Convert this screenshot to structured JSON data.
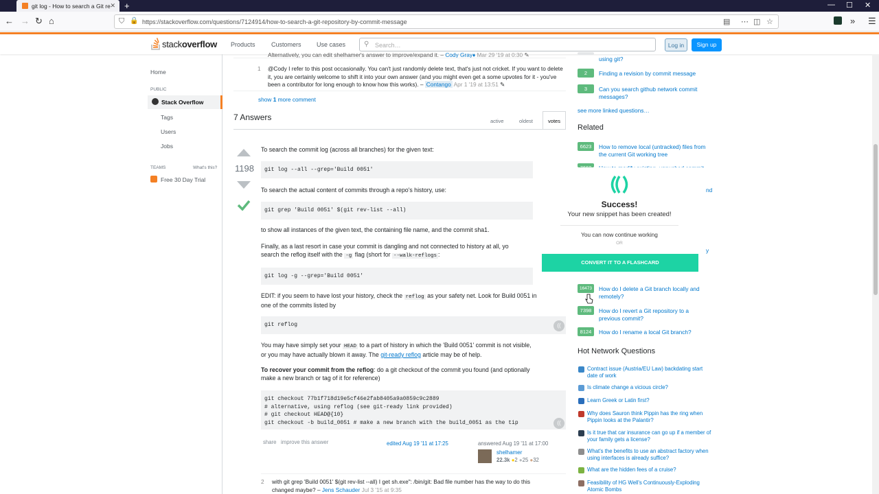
{
  "browser": {
    "tab_title": "git log - How to search a Git re",
    "url": "https://stackoverflow.com/questions/7124914/how-to-search-a-git-repository-by-commit-message"
  },
  "topbar": {
    "logo_prefix": "stack",
    "logo_suffix": "overflow",
    "nav": [
      "Products",
      "Customers",
      "Use cases"
    ],
    "search_placeholder": "Search…",
    "login": "Log in",
    "signup": "Sign up"
  },
  "leftnav": {
    "home": "Home",
    "public": "PUBLIC",
    "stack_overflow": "Stack Overflow",
    "tags": "Tags",
    "users": "Users",
    "jobs": "Jobs",
    "teams": "TEAMS",
    "whats_this": "What's this?",
    "trial": "Free 30 Day Trial"
  },
  "comments": {
    "top_partial": "Alternatively, you can edit shelhamer's answer to improve/expand it. –",
    "top_author": "Cody Gray♦",
    "top_date": "Mar 29 '19 at 0:30",
    "c1_votes": "1",
    "c1_text": "@Cody I refer to this post occasionally. You can't just randomly delete text, that's just not cricket. If you want to delete it, you are certainly welcome to shift it into your own answer (and you might even get a some upvotes for it - you've been a contributor for long enough to know how this works). –",
    "c1_author": "Contango",
    "c1_date": "Apr 1 '19 at 13:51",
    "show_prefix": "show",
    "show_count": "1",
    "show_suffix": "more comment"
  },
  "answers": {
    "heading": "7 Answers",
    "sort_tabs": [
      "active",
      "oldest",
      "votes"
    ]
  },
  "answer": {
    "votes": "1198",
    "p1": "To search the commit log (across all branches) for the given text:",
    "code1": "git log --all --grep='Build 0051'",
    "p2": "To search the actual content of commits through a repo's history, use:",
    "code2": "git grep 'Build 0051' $(git rev-list --all)",
    "p3": "to show all instances of the given text, the containing file name, and the commit sha1.",
    "p4a": "Finally, as a last resort in case your commit is dangling and not connected to history at all, yo",
    "p4b": "search the reflog itself with the",
    "p4_flag": "-g",
    "p4c": "flag (short for",
    "p4_long": "--walk-reflogs",
    "p4d": ":",
    "code3": "git log -g --grep='Build 0051'",
    "p5a": "EDIT: if you seem to have lost your history, check the",
    "p5_code": "reflog",
    "p5b": "as your safety net. Look for Build 0051 in",
    "p5c": "one of the commits listed by",
    "code4": "git reflog",
    "p6a": "You may have simply set your",
    "p6_code": "HEAD",
    "p6b": "to a part of history in which the 'Build 0051' commit is not visible,",
    "p6c": "or you may have actually blown it away. The",
    "p6_link": "git-ready reflog",
    "p6d": "article may be of help.",
    "p7_bold": "To recover your commit from the reflog",
    "p7a": ": do a git checkout of the commit you found (and optionally",
    "p7b": "make a new branch or tag of it for reference)",
    "code5": [
      "git checkout 77b1f718d19e5cf46e2fab8405a9a0859c9c2889",
      "# alternative, using reflog (see git-ready link provided)",
      "# git checkout HEAD@{10}",
      "git checkout -b build_0051 # make a new branch with the build_0051 as the tip"
    ],
    "share": "share",
    "improve": "improve this answer",
    "edited": "edited Aug 19 '11 at 17:25",
    "answered": "answered Aug 19 '11 at 17:00",
    "user": "shelhamer",
    "rep": "22.3k",
    "gold": "2",
    "silver": "25",
    "bronze": "32",
    "comment_votes": "2",
    "comment_a": "with git grep 'Build 0051' $(git rev-list --all) I get sh.exe\": /bin/git: Bad file number has the way to do this",
    "comment_b": "changed maybe? –",
    "comment_author": "Jens Schauder",
    "comment_date": "Jul 3 '15 at 9:35"
  },
  "linked": {
    "top_partial": "using git?",
    "items": [
      {
        "count": "2",
        "title": "Finding a revision by commit message"
      },
      {
        "count": "3",
        "title": "Can you search github network commit messages?"
      }
    ],
    "see_more": "see more linked questions…"
  },
  "related": {
    "heading": "Related",
    "items": [
      {
        "count": "6623",
        "title": "How to remove local (untracked) files from the current Git working tree"
      },
      {
        "count": "7668",
        "title": "How to modify existing, unpushed commit"
      },
      {
        "count": "16473",
        "title": "How do I delete a Git branch locally and remotely?"
      },
      {
        "count": "7398",
        "title": "How do I revert a Git repository to a previous commit?"
      },
      {
        "count": "8124",
        "title": "How do I rename a local Git branch?"
      }
    ],
    "peek_nd": "nd",
    "peek_y": "y"
  },
  "hnq": {
    "heading": "Hot Network Questions",
    "items": [
      "Contract issue (Austria/EU Law) backdating start date of work",
      "Is climate change a vicious circle?",
      "Learn Greek or Latin first?",
      "Why does Sauron think Pippin has the ring when Pippin looks at the Palantir?",
      "Is it true that car insurance can go up if a member of your family gets a license?",
      "What's the benefits to use an abstract factory when using interfaces is already suffice?",
      "What are the hidden fees of a cruise?",
      "Feasibility of HG Well's Continuously-Exploding Atomic Bombs"
    ]
  },
  "popup": {
    "title": "Success!",
    "subtitle": "Your new snippet has been created!",
    "continue": "You can now continue working",
    "or": "OR",
    "button": "CONVERT IT TO A FLASHCARD"
  },
  "colors": {
    "accent": "#f48024",
    "link": "#0077cc",
    "accepted": "#5eba7d",
    "popup_teal": "#1dd3a4"
  }
}
